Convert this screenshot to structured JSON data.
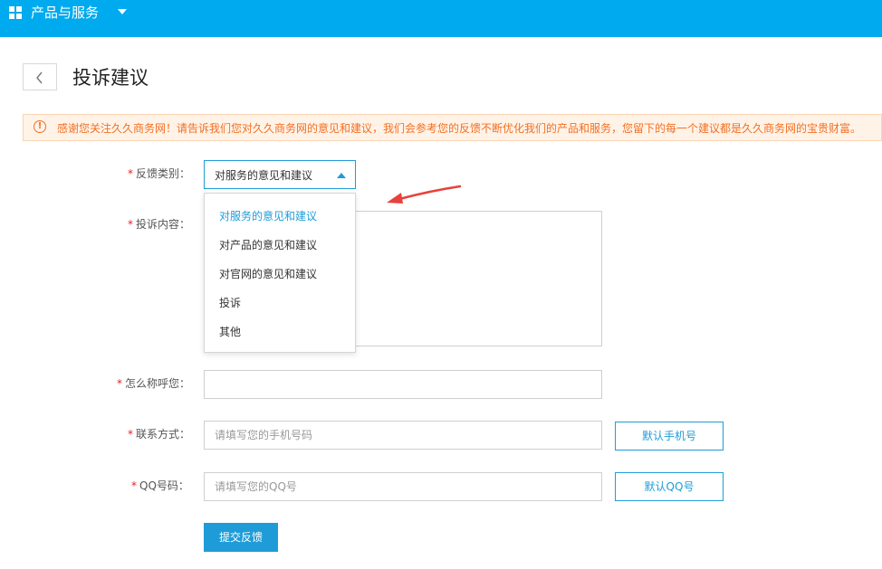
{
  "header": {
    "title": "产品与服务",
    "icon": "grid-icon",
    "dropdown_icon": "caret-down-icon",
    "background": "#00aaee"
  },
  "page": {
    "title": "投诉建议",
    "back_icon": "chevron-left-icon"
  },
  "notice": {
    "icon": "exclamation-circle-icon",
    "text": "感谢您关注久久商务网！请告诉我们您对久久商务网的意见和建议，我们会参考您的反馈不断优化我们的产品和服务，您留下的每一个建议都是久久商务网的宝贵财富。",
    "color": "#f36f21"
  },
  "form": {
    "required_mark": "*",
    "category": {
      "label": "反馈类别：",
      "value": "对服务的意见和建议",
      "options": [
        "对服务的意见和建议",
        "对产品的意见和建议",
        "对官网的意见和建议",
        "投诉",
        "其他"
      ]
    },
    "content": {
      "label": "投诉内容："
    },
    "name": {
      "label": "怎么称呼您：",
      "value": ""
    },
    "phone": {
      "label": "联系方式：",
      "placeholder": "请填写您的手机号码",
      "button": "默认手机号"
    },
    "qq": {
      "label": "QQ号码：",
      "placeholder": "请填写您的QQ号",
      "button": "默认QQ号"
    },
    "submit": "提交反馈"
  },
  "accent_color": "#1f9cd8",
  "annotation": {
    "icon": "red-arrow-icon",
    "color": "#e8413a"
  }
}
